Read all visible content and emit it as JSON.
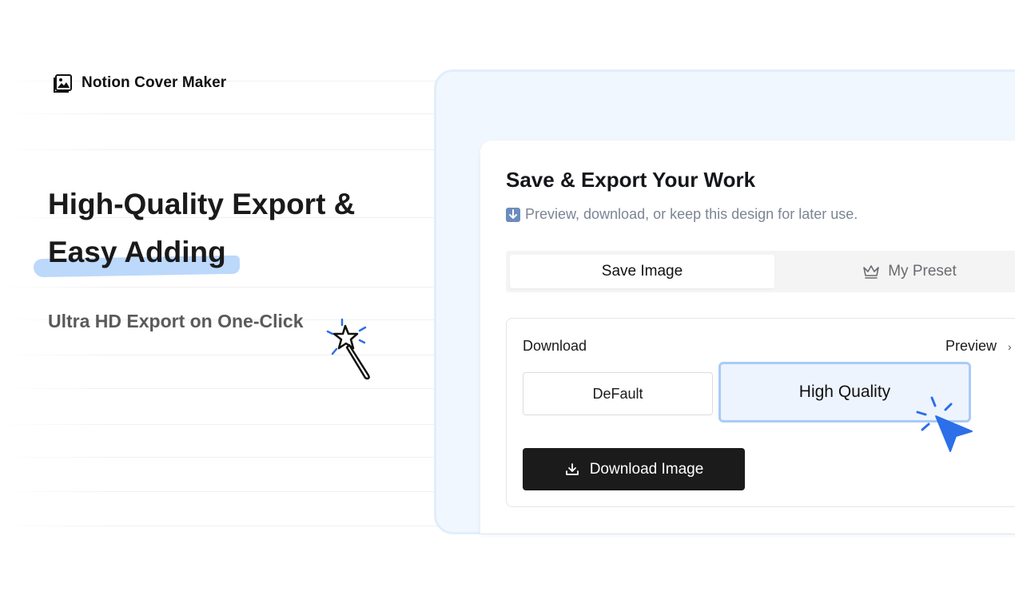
{
  "brand": {
    "name": "Notion Cover Maker",
    "icon": "image-frame-icon"
  },
  "hero": {
    "headline_line1": "High-Quality Export &",
    "headline_line2": "Easy Adding",
    "subtitle": "Ultra HD Export on One-Click",
    "decoration_icon": "magic-wand-icon"
  },
  "card": {
    "title": "Save & Export Your Work",
    "description_icon": "down-arrow-emoji-icon",
    "description": "Preview, download, or keep this design for later use.",
    "tabs": [
      {
        "label": "Save Image",
        "active": true
      },
      {
        "label": "My Preset",
        "active": false,
        "icon": "crown-icon"
      }
    ],
    "download": {
      "label": "Download",
      "preview_label": "Preview",
      "options": [
        {
          "label": "DeFault",
          "selected": false
        },
        {
          "label": "High Quality",
          "selected": true
        }
      ],
      "button_label": "Download Image",
      "button_icon": "download-icon"
    },
    "pointer_icon": "cursor-click-icon"
  },
  "colors": {
    "accent": "#2c6fe8",
    "highlight": "#bcd8fb",
    "panel_bg": "#f1f7fe",
    "selected_border": "#a9cbf7",
    "button_bg": "#1b1b1b"
  }
}
